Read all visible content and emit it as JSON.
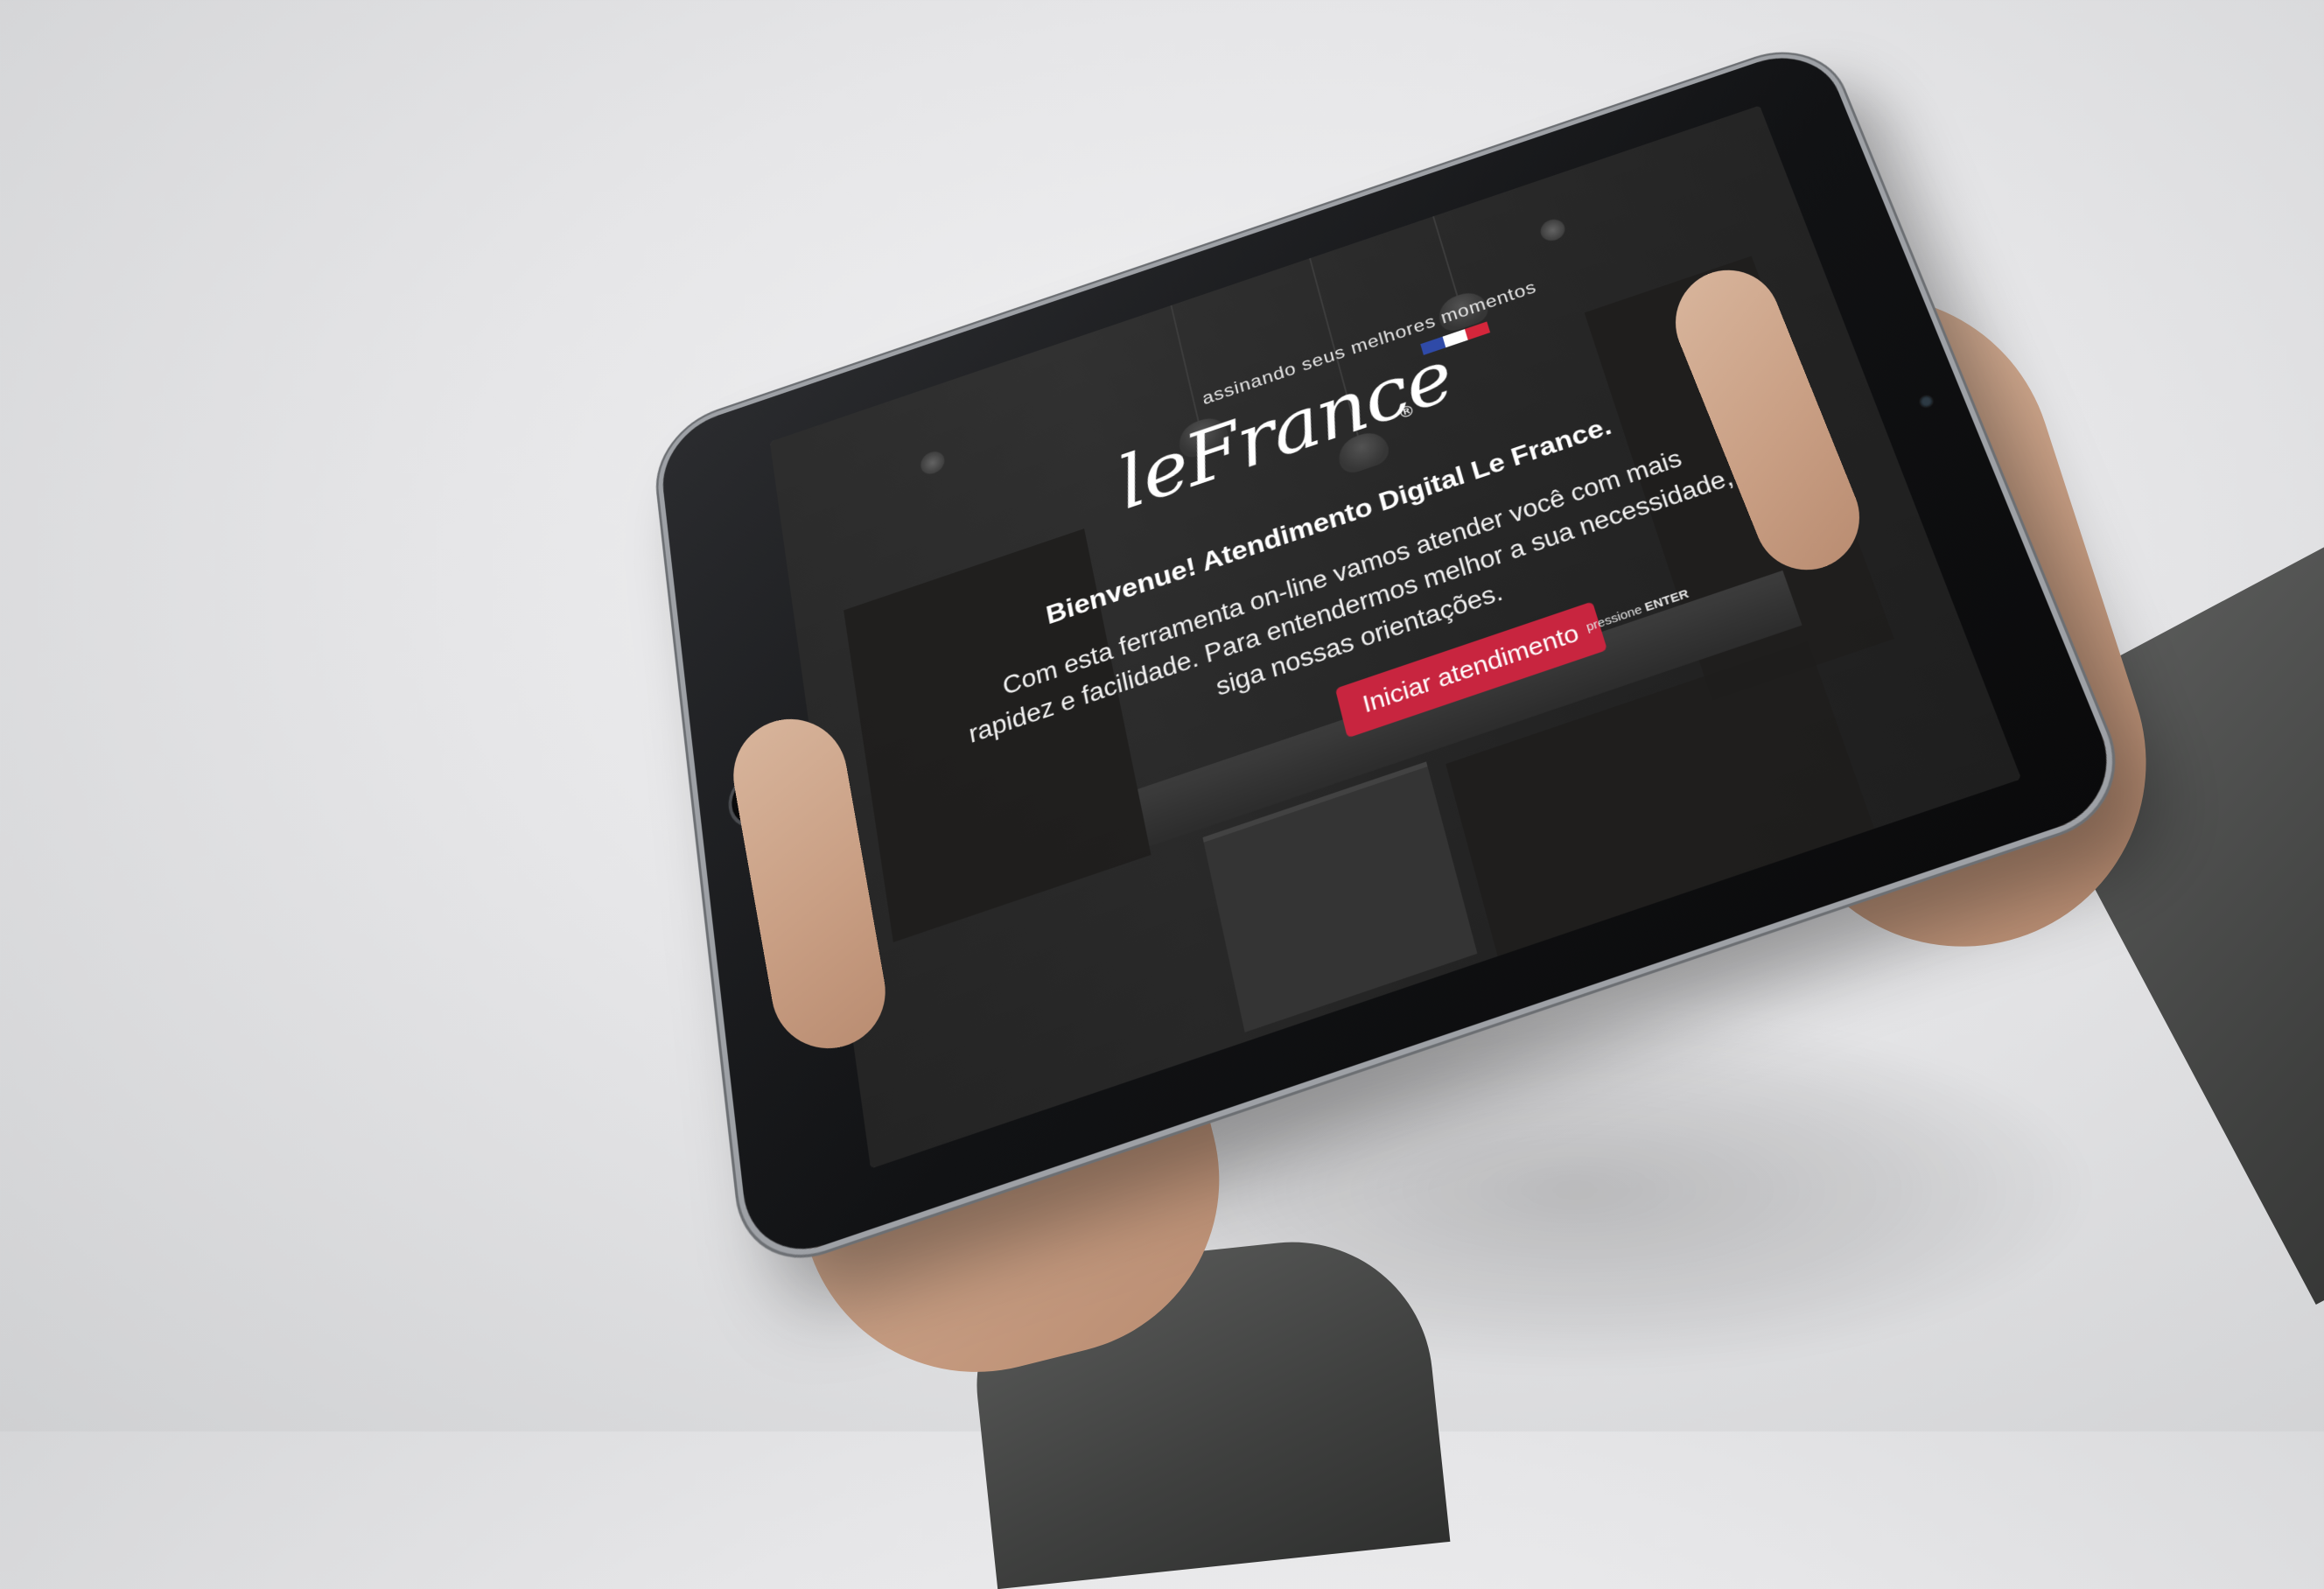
{
  "logo": {
    "tagline": "assinando seus melhores momentos",
    "wordmark": "leFrance",
    "registered": "®",
    "flag_colors": [
      "#2f4aa8",
      "#ffffff",
      "#d4263b"
    ]
  },
  "welcome": {
    "title": "Bienvenue! Atendimento Digital Le France.",
    "description": "Com esta ferramenta on-line vamos atender você com mais rapidez e facilidade. Para entendermos melhor a sua necessidade, siga nossas orientações."
  },
  "cta": {
    "button_label": "Iniciar atendimento",
    "hint_prefix": "pressione",
    "hint_key": "ENTER"
  },
  "colors": {
    "accent": "#c8253f",
    "overlay": "#121212"
  }
}
